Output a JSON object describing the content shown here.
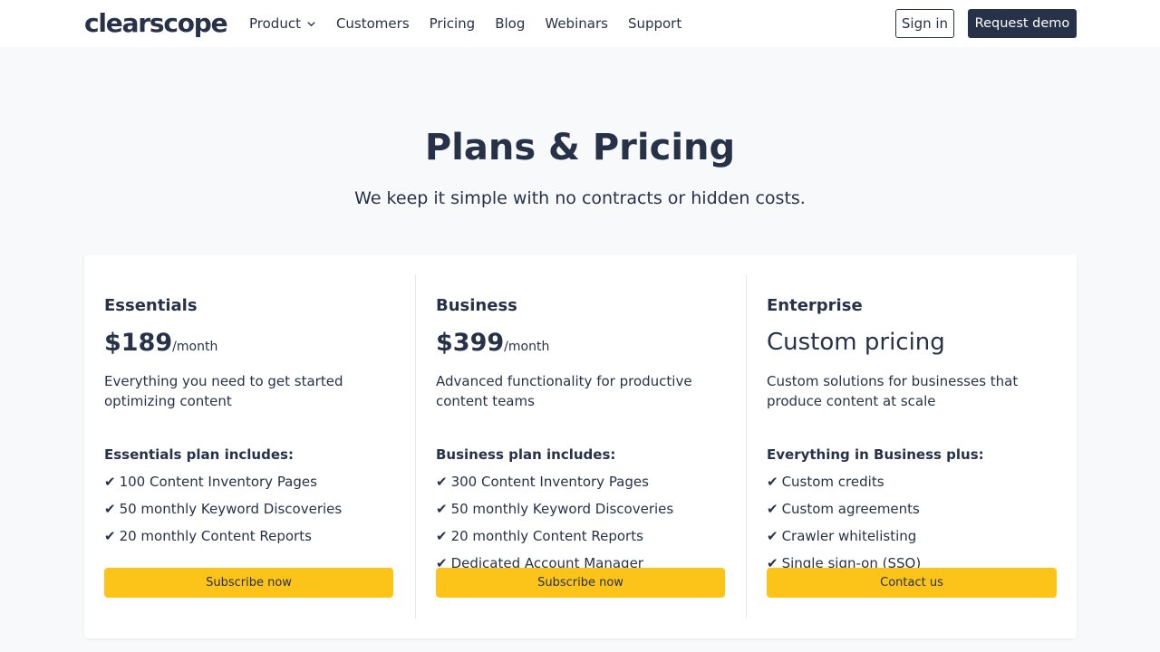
{
  "header": {
    "logo": "clearscope",
    "nav": [
      {
        "label": "Product",
        "has_dropdown": true
      },
      {
        "label": "Customers"
      },
      {
        "label": "Pricing"
      },
      {
        "label": "Blog"
      },
      {
        "label": "Webinars"
      },
      {
        "label": "Support"
      }
    ],
    "sign_in": "Sign in",
    "request_demo": "Request demo"
  },
  "hero": {
    "title": "Plans & Pricing",
    "subtitle": "We keep it simple with no contracts or hidden costs."
  },
  "plans": [
    {
      "name": "Essentials",
      "price": "$189",
      "per": "/month",
      "description": "Everything you need to get started optimizing content",
      "includes_heading": "Essentials plan includes:",
      "features": [
        "100 Content Inventory Pages",
        "50 monthly Keyword Discoveries",
        "20 monthly Content Reports"
      ],
      "cta": "Subscribe now"
    },
    {
      "name": "Business",
      "price": "$399",
      "per": "/month",
      "description": "Advanced functionality for productive content teams",
      "includes_heading": "Business plan includes:",
      "features": [
        "300 Content Inventory Pages",
        "50 monthly Keyword Discoveries",
        "20 monthly Content Reports",
        "Dedicated Account Manager"
      ],
      "cta": "Subscribe now"
    },
    {
      "name": "Enterprise",
      "price": "Custom pricing",
      "description": "Custom solutions for businesses that produce content at scale",
      "includes_heading": "Everything in Business plus:",
      "features": [
        "Custom credits",
        "Custom agreements",
        "Crawler whitelisting",
        "Single sign-on (SSO)"
      ],
      "cta": "Contact us"
    }
  ],
  "check_glyph": "✔",
  "colors": {
    "text": "#273249",
    "page_bg": "#f8f9fb",
    "cta_yellow": "#fcc419",
    "demo_button_bg": "#273249"
  }
}
